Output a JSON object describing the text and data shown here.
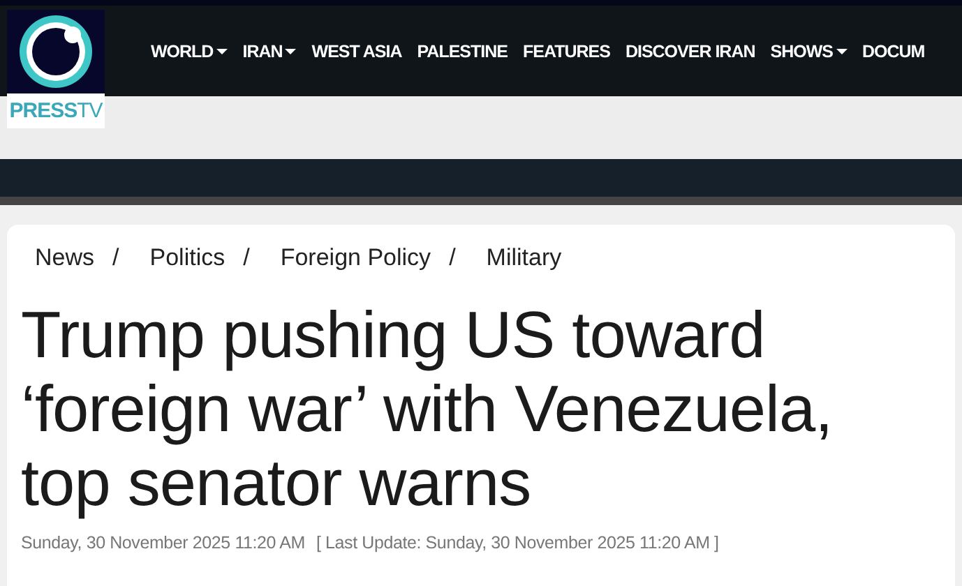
{
  "logo": {
    "wordmark_bold": "PRESS",
    "wordmark_light": "TV"
  },
  "nav": [
    {
      "label": "WORLD",
      "has_menu": true
    },
    {
      "label": "IRAN",
      "has_menu": true
    },
    {
      "label": "WEST ASIA",
      "has_menu": false
    },
    {
      "label": "PALESTINE",
      "has_menu": false
    },
    {
      "label": "FEATURES",
      "has_menu": false
    },
    {
      "label": "DISCOVER IRAN",
      "has_menu": false
    },
    {
      "label": "SHOWS",
      "has_menu": true
    },
    {
      "label": "DOCUM",
      "has_menu": false
    }
  ],
  "breadcrumb": {
    "items": [
      "News",
      "Politics",
      "Foreign Policy",
      "Military"
    ],
    "separator": "/"
  },
  "article": {
    "headline": "Trump pushing US toward ‘foreign war’ with Venezuela, top senator warns",
    "published": "Sunday, 30 November 2025 11:20 AM",
    "last_update": "[ Last Update: Sunday, 30 November 2025 11:20 AM ]"
  }
}
